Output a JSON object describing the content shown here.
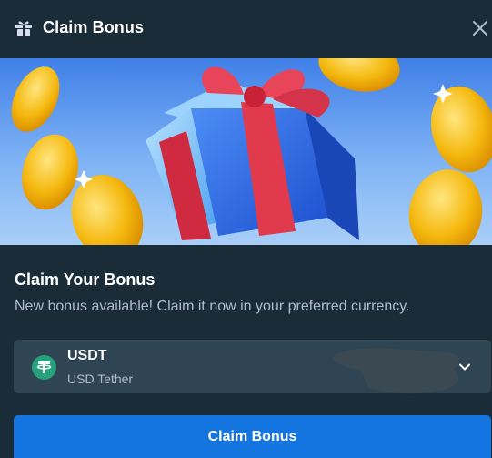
{
  "header": {
    "title": "Claim Bonus",
    "icon": "gift-icon",
    "close_icon": "close-icon"
  },
  "banner": {
    "description_icon": "gift-box-and-coins-illustration"
  },
  "content": {
    "title": "Claim Your Bonus",
    "subtitle": "New bonus available! Claim it now in your preferred currency."
  },
  "currency": {
    "code": "USDT",
    "name": "USD Tether",
    "icon": "tether-icon",
    "icon_color": "#26a17b"
  },
  "claim_button": {
    "label": "Claim Bonus"
  },
  "colors": {
    "background": "#1a2c38",
    "select_bg": "#2f4553",
    "accent": "#1475e1",
    "muted_text": "#b1bad3"
  }
}
